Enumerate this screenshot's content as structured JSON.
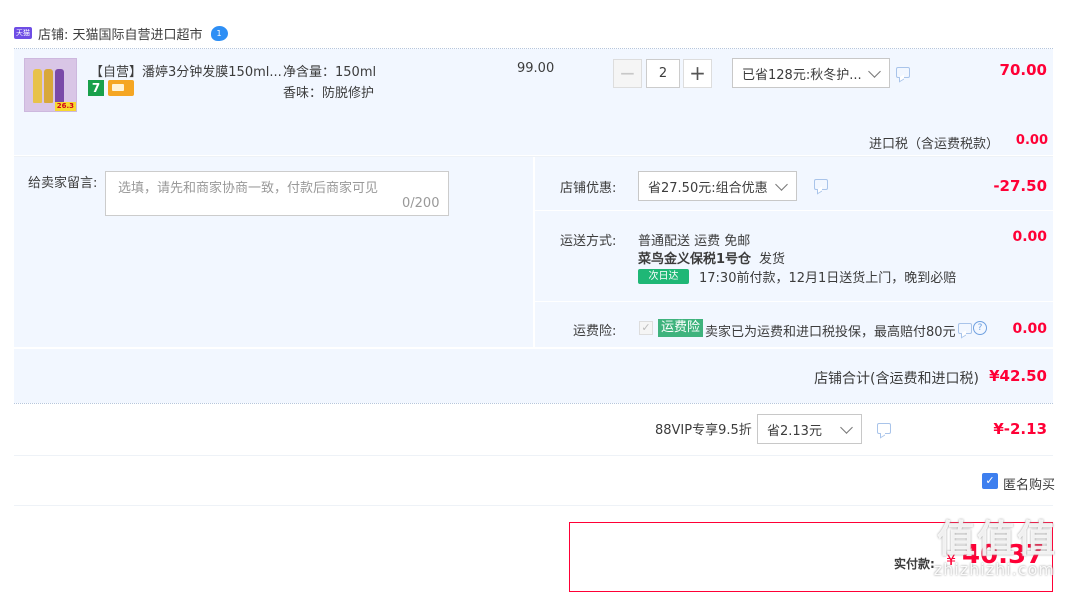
{
  "shop": {
    "label": "店铺: 天猫国际自营进口超市",
    "logo_text": "天猫",
    "wangwang_icon_text": "1"
  },
  "item": {
    "title": "【自营】潘婷3分钟发膜150ml...",
    "badge_seven": "7",
    "thumb_price": "26.3",
    "attr_net": "净含量：150ml",
    "attr_scent": "香味：防脱修护",
    "unit_price": "99.00",
    "quantity": "2",
    "qty_minus": "−",
    "qty_plus": "+",
    "promo_select": "已省128元:秋冬护...",
    "subtotal": "70.00"
  },
  "tax": {
    "label": "进口税（含运费税款）",
    "amount": "0.00"
  },
  "message": {
    "label": "给卖家留言:",
    "placeholder": "选填，请先和商家协商一致，付款后商家可见",
    "counter": "0/200"
  },
  "shop_discount": {
    "label": "店铺优惠:",
    "select": "省27.50元:组合优惠",
    "amount": "-27.50"
  },
  "shipping": {
    "label": "运送方式:",
    "method": "普通配送 运费 免邮",
    "warehouse": "菜鸟金义保税1号仓",
    "dispatch": "发货",
    "tag": "次日达",
    "promise": "17:30前付款，12月1日送货上门，晚到必赔",
    "amount": "0.00"
  },
  "insurance": {
    "label": "运费险:",
    "check": "✓",
    "tag": "运费险",
    "desc": "卖家已为运费和进口税投保，最高赔付80元",
    "help": "?",
    "amount": "0.00"
  },
  "shop_total": {
    "label": "店铺合计(含运费和进口税)",
    "amount": "¥42.50"
  },
  "vip": {
    "label": "88VIP专享9.5折",
    "select": "省2.13元",
    "amount": "¥-2.13"
  },
  "anonymous": {
    "check": "✓",
    "label": "匿名购买"
  },
  "payment": {
    "label": "实付款:",
    "currency": "¥",
    "amount": "40.37"
  },
  "watermark": {
    "text": "值值值",
    "site": "zhizhizhi.com"
  },
  "colors": {
    "price_red": "#ff0036",
    "panel_blue": "#f2f7ff",
    "accent_blue": "#3d7fef",
    "tag_green": "#1fb776"
  }
}
